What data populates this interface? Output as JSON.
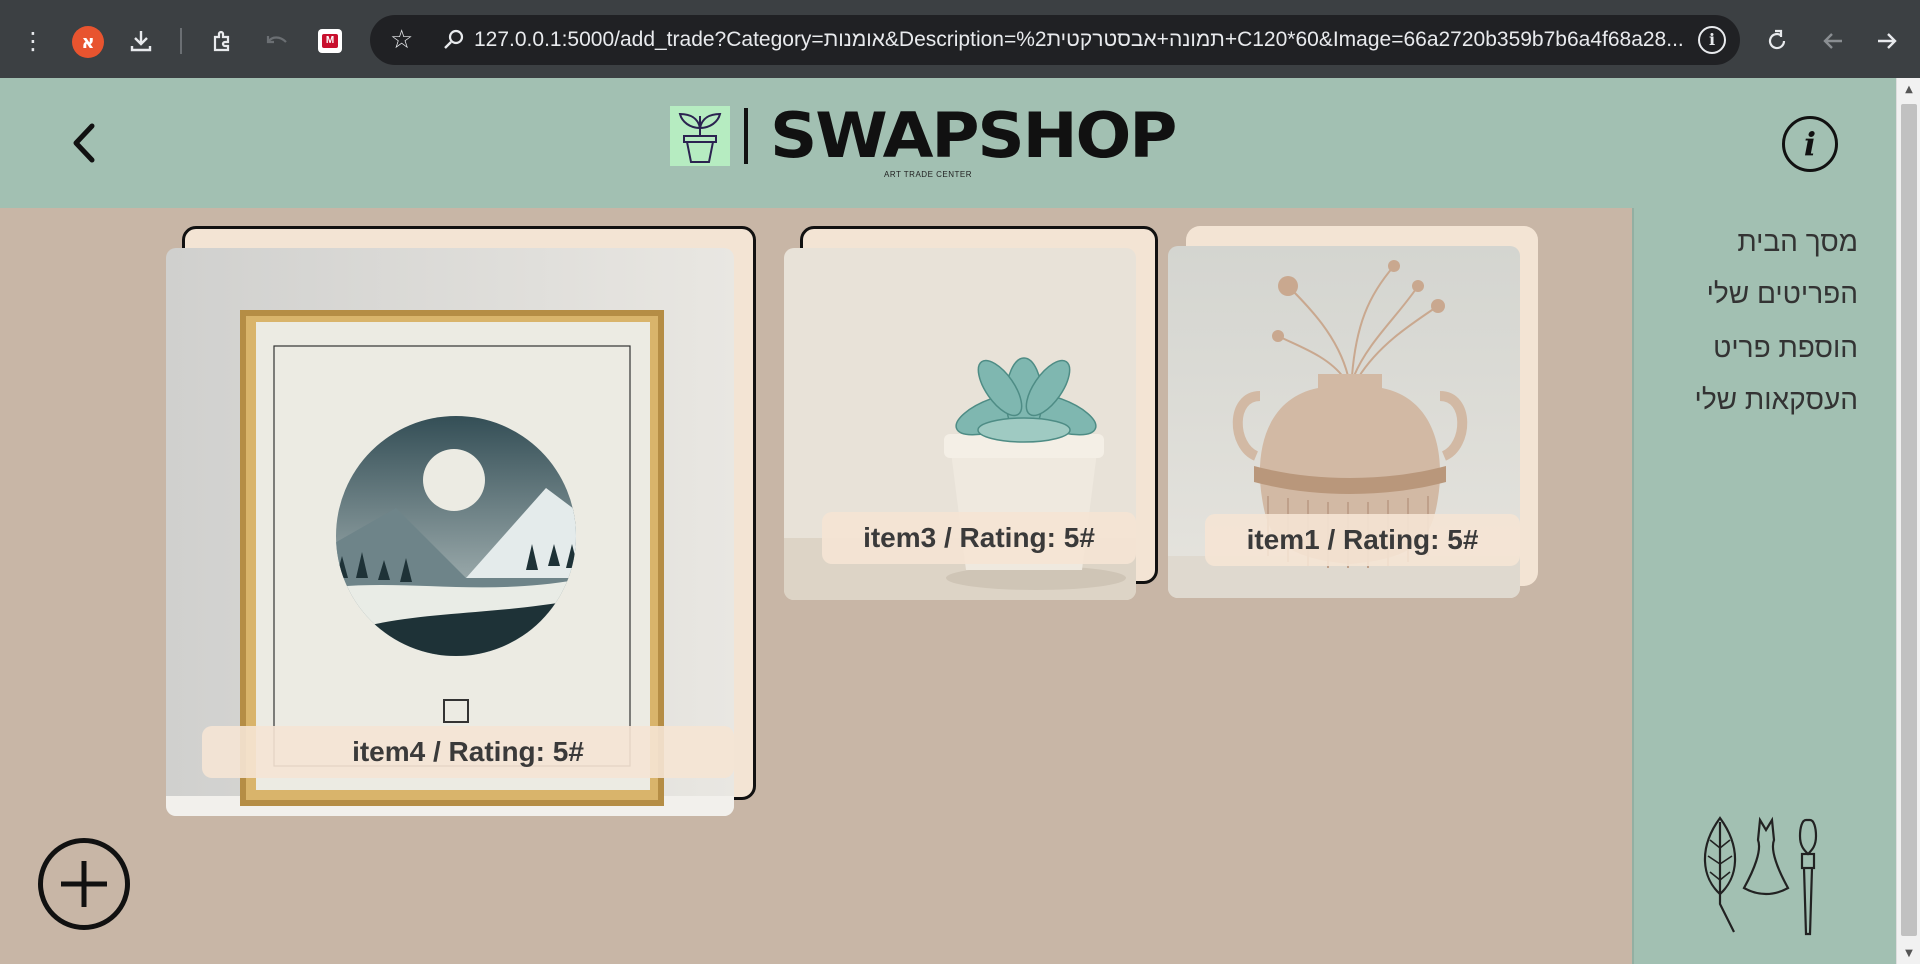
{
  "browser": {
    "profile_badge": "א",
    "url": "127.0.0.1:5000/add_trade?Category=אומנות&Description=%2תמונה+אבסטרקטית+C120*60&Image=66a2720b359b7b6a4f68a28..."
  },
  "header": {
    "logo_text": "SWAPSHOP",
    "logo_subtitle": "ART TRADE CENTER"
  },
  "sidebar": {
    "items": [
      {
        "label": "מסך הבית"
      },
      {
        "label": "הפריטים שלי"
      },
      {
        "label": "הוספת פריט"
      },
      {
        "label": "העסקאות שלי"
      }
    ]
  },
  "cards": [
    {
      "label": "item1 / Rating: 5#",
      "image": "vase-with-dried-flowers",
      "selected": false
    },
    {
      "label": "item3 / Rating: 5#",
      "image": "succulent-in-pot",
      "selected": true
    },
    {
      "label": "item4 / Rating: 5#",
      "image": "framed-mountain-art",
      "selected": true
    }
  ]
}
